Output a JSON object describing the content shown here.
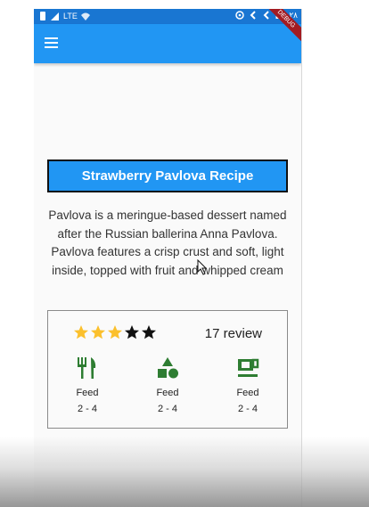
{
  "status_bar": {
    "network": "LTE",
    "time": "۲۸",
    "debug_label": "DEBUG"
  },
  "app_bar": {
    "menu_icon": "hamburger-menu-icon"
  },
  "recipe": {
    "title": "Strawberry Pavlova Recipe",
    "description": "Pavlova is a meringue-based dessert named after the Russian ballerina Anna Pavlova. Pavlova features a crisp crust and soft, light inside, topped with fruit and whipped cream"
  },
  "rating": {
    "stars_filled": 3,
    "stars_total": 5,
    "filled_color": "#fbc02d",
    "empty_color": "#111111",
    "review_text": "17 review"
  },
  "features": [
    {
      "icon": "restaurant-icon",
      "label": "Feed",
      "range": "2 - 4"
    },
    {
      "icon": "category-shapes-icon",
      "label": "Feed",
      "range": "2 - 4"
    },
    {
      "icon": "coffee-icon",
      "label": "Feed",
      "range": "2 - 4"
    }
  ],
  "colors": {
    "status_bar": "#1976d2",
    "app_bar": "#2196f3",
    "accent_green": "#2e7d32",
    "debug_ribbon": "#a31b22"
  }
}
